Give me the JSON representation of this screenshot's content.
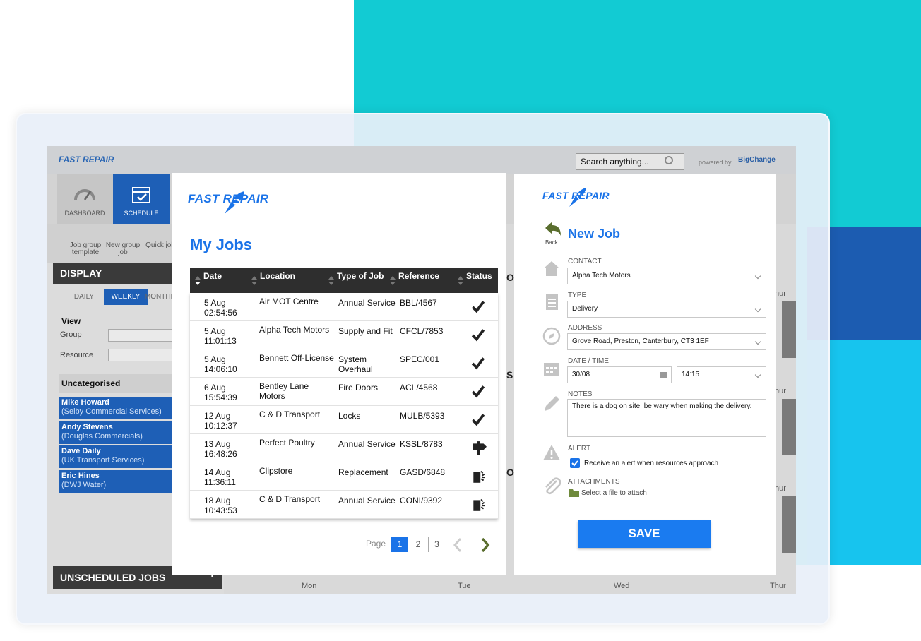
{
  "colors": {
    "teal": "#12cbd3",
    "navy": "#1c5cb1",
    "brand_blue": "#1a73e8",
    "header_dark": "#2e2e2e"
  },
  "app": {
    "brand": "FAST REPAIR",
    "search_placeholder": "Search anything...",
    "powered_by": "powered by",
    "partner": "BigChange",
    "nav": {
      "dashboard": "DASHBOARD",
      "schedule": "SCHEDULE"
    },
    "subnav": [
      "Job group template",
      "New group job",
      "Quick job"
    ],
    "display_heading": "DISPLAY",
    "display_tabs": [
      "DAILY",
      "WEEKLY",
      "MONTHLY"
    ],
    "view_label": "View",
    "group_label": "Group",
    "resource_label": "Resource",
    "uncategorised": "Uncategorised",
    "resources": [
      {
        "name": "Mike Howard",
        "company": "(Selby Commercial Services)"
      },
      {
        "name": "Andy Stevens",
        "company": "(Douglas Commercials)"
      },
      {
        "name": "Dave Daily",
        "company": "(UK Transport Services)"
      },
      {
        "name": "Eric Hines",
        "company": "(DWJ Water)"
      }
    ],
    "unscheduled": "UNSCHEDULED JOBS",
    "unscheduled_plus": "+",
    "days": [
      "Mon",
      "Tue",
      "Wed",
      "Thur"
    ],
    "thur_labels": [
      "hur",
      "hur",
      "hur"
    ],
    "partials": [
      "OM",
      "S C",
      "OI"
    ]
  },
  "jobs": {
    "brand": "FAST REPAIR",
    "title": "My Jobs",
    "columns": [
      "Date",
      "Location",
      "Type of Job",
      "Reference",
      "Status"
    ],
    "rows": [
      {
        "date": "5 Aug",
        "time": "02:54:56",
        "location": "Air MOT Centre",
        "type": "Annual Service",
        "reference": "BBL/4567",
        "status": "check-icon"
      },
      {
        "date": "5 Aug",
        "time": "11:01:13",
        "location": "Alpha Tech Motors",
        "type": "Supply and Fit",
        "reference": "CFCL/7853",
        "status": "check-icon"
      },
      {
        "date": "5 Aug",
        "time": "14:06:10",
        "location": "Bennett Off-License",
        "type": "System Overhaul",
        "reference": "SPEC/001",
        "status": "check-icon"
      },
      {
        "date": "6 Aug",
        "time": "15:54:39",
        "location": "Bentley Lane Motors",
        "type": "Fire Doors",
        "reference": "ACL/4568",
        "status": "check-icon"
      },
      {
        "date": "12 Aug",
        "time": "10:12:37",
        "location": "C & D Transport",
        "type": "Locks",
        "reference": "MULB/5393",
        "status": "check-icon"
      },
      {
        "date": "13 Aug",
        "time": "16:48:26",
        "location": "Perfect Poultry",
        "type": "Annual Service",
        "reference": "KSSL/8783",
        "status": "signpost-icon"
      },
      {
        "date": "14 Aug",
        "time": "11:36:11",
        "location": "Clipstore",
        "type": "Replacement",
        "reference": "GASD/6848",
        "status": "document-loading-icon"
      },
      {
        "date": "18 Aug",
        "time": "10:43:53",
        "location": "C & D Transport",
        "type": "Annual Service",
        "reference": "CONI/9392",
        "status": "document-loading-icon"
      }
    ],
    "pager": {
      "label": "Page",
      "pages": [
        "1",
        "2",
        "3"
      ],
      "current": "1"
    }
  },
  "newjob": {
    "brand": "FAST REPAIR",
    "title": "New Job",
    "back": "Back",
    "contact_label": "CONTACT",
    "contact_value": "Alpha Tech Motors",
    "type_label": "TYPE",
    "type_value": "Delivery",
    "address_label": "ADDRESS",
    "address_value": "Grove Road, Preston, Canterbury, CT3 1EF",
    "datetime_label": "DATE / TIME",
    "date_value": "30/08",
    "time_value": "14:15",
    "notes_label": "NOTES",
    "notes_value": "There is a dog on site, be wary when making the delivery.",
    "alert_label": "ALERT",
    "alert_text": "Receive an alert when resources approach",
    "alert_checked": true,
    "attachments_label": "ATTACHMENTS",
    "attach_text": "Select a file to attach",
    "save": "SAVE"
  }
}
